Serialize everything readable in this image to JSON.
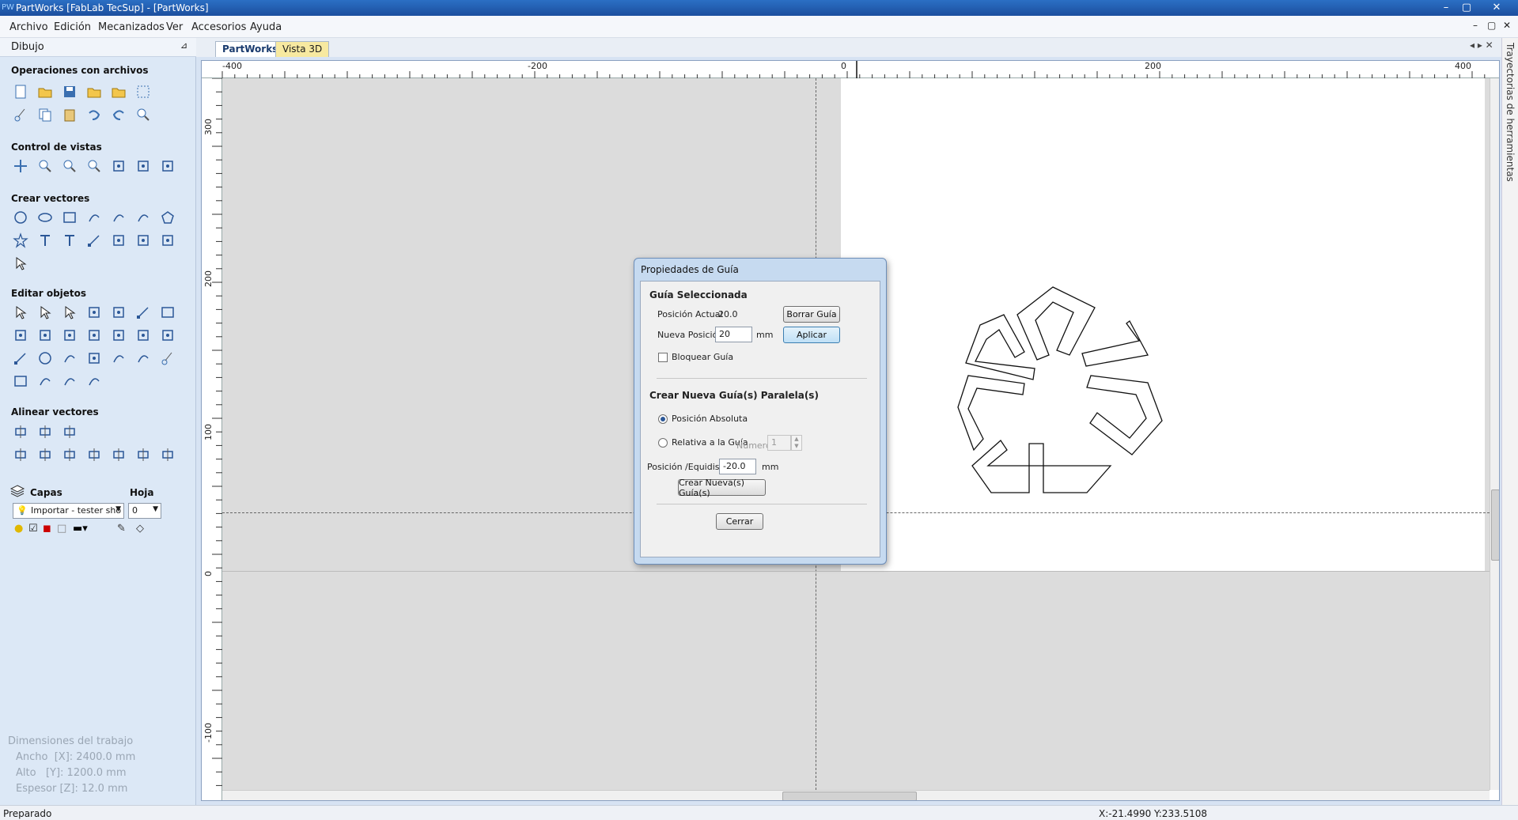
{
  "window": {
    "icon_text": "PW",
    "title": "PartWorks [FabLab TecSup] - [PartWorks]",
    "controls": [
      "–",
      "▢",
      "✕"
    ]
  },
  "menu": {
    "items": [
      "Archivo",
      "Edición",
      "Mecanizados",
      "Ver",
      "Accesorios",
      "Ayuda"
    ],
    "child_controls": [
      "–",
      "▢",
      "✕"
    ]
  },
  "left_panel": {
    "title": "Dibujo",
    "pin": "⊿",
    "sections": {
      "files": "Operaciones con archivos",
      "views": "Control de vistas",
      "vectors": "Crear vectores",
      "edit": "Editar objetos",
      "align": "Alinear vectores"
    },
    "layers": {
      "label": "Capas",
      "sheet_label": "Hoja",
      "layer_value": "Importar - tester sho",
      "sheet_value": "0"
    },
    "job_dimensions": {
      "title": "Dimensiones del trabajo",
      "width": "Ancho  [X]: 2400.0 mm",
      "height": "Alto   [Y]: 1200.0 mm",
      "thickness": "Espesor [Z]: 12.0 mm"
    }
  },
  "tabs": [
    "PartWorks",
    "Vista 3D"
  ],
  "tab_nav": "◂ ▸ ✕",
  "right_strip": {
    "label": "Trayectorias de herramientas"
  },
  "rulers": {
    "horizontal": [
      "-400",
      "-200",
      "0",
      "200",
      "400"
    ],
    "vertical": [
      "300",
      "200",
      "100",
      "0",
      "-100"
    ]
  },
  "dialog": {
    "title": "Propiedades de Guía",
    "selected_section": "Guía Seleccionada",
    "current_position_label": "Posición Actual",
    "current_position_value": "-20.0",
    "delete_button": "Borrar Guía",
    "new_position_label": "Nueva Posición",
    "new_position_value": "20",
    "unit": "mm",
    "apply_button": "Aplicar",
    "lock_label": "Bloquear Guía",
    "lock_checked": false,
    "create_section": "Crear Nueva Guía(s) Paralela(s)",
    "absolute_label": "Posición Absoluta",
    "absolute_selected": true,
    "relative_label": "Relativa a la Guía",
    "number_label": "Numero",
    "number_value": "1",
    "position_spacing_label": "Posición /Equidistancia",
    "position_spacing_value": "-20.0",
    "spacing_unit": "mm",
    "create_button": "Crear Nueva(s) Guía(s)",
    "close_button": "Cerrar"
  },
  "statusbar": {
    "left": "Preparado",
    "coords": "X:-21.4990 Y:233.5108"
  },
  "colors": {
    "titlebar": "#1c4f9e",
    "panel_bg": "#dce8f6",
    "canvas_gray": "#dcdcdc",
    "sheet_white": "#ffffff"
  }
}
